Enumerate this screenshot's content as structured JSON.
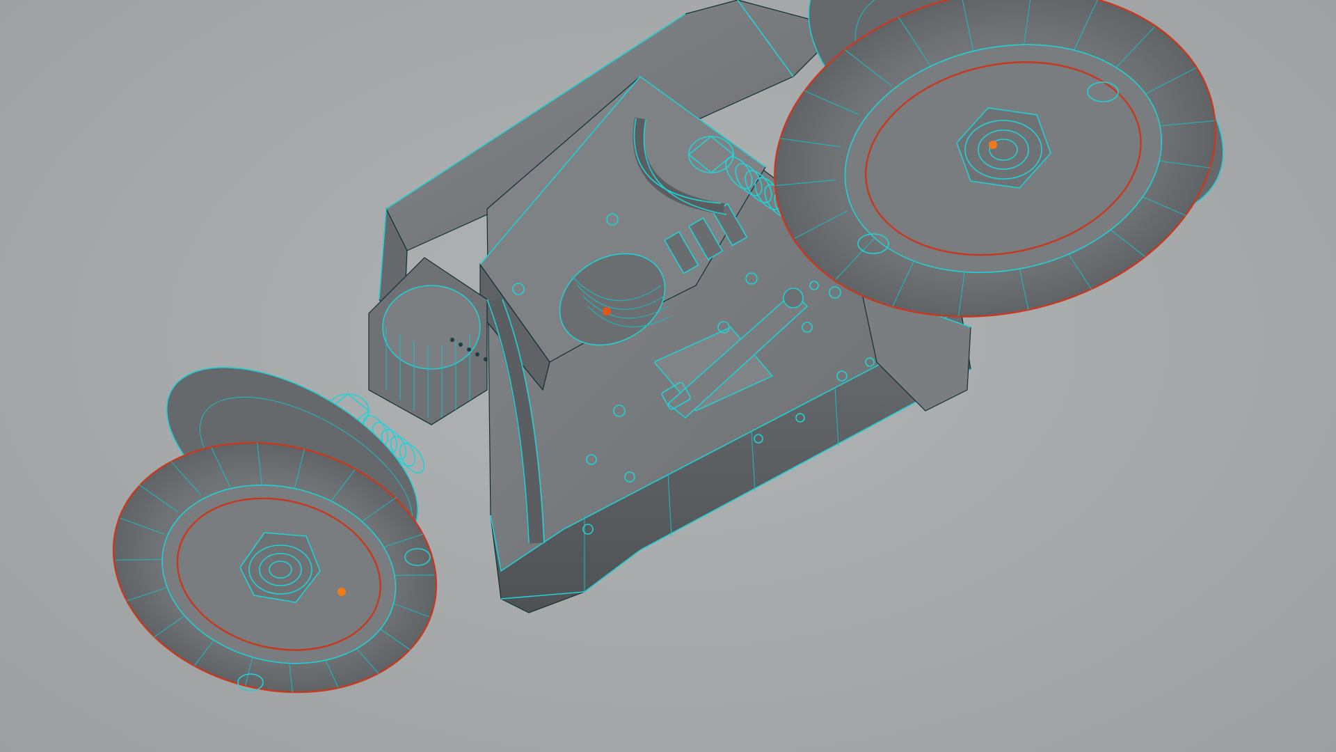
{
  "viewport": {
    "background_color": "#a7aaab",
    "wire_color": "#22d1d6",
    "seam_color": "#c8381f",
    "vertex_highlight_color": "#f07a1a"
  },
  "scene": {
    "model": "wheeled-robot-chassis",
    "display_mode": "shaded-wireframe",
    "visible_parts": [
      "chassis-body",
      "front-left-wheel",
      "front-right-wheel",
      "rear-wheels",
      "motor-gearbox",
      "springs",
      "mounting-bolts",
      "cable-harness"
    ]
  },
  "icons": {
    "wheel": "wheel-icon",
    "nut": "hex-nut-icon",
    "spring": "coil-spring-icon",
    "bolt": "bolt-icon"
  }
}
